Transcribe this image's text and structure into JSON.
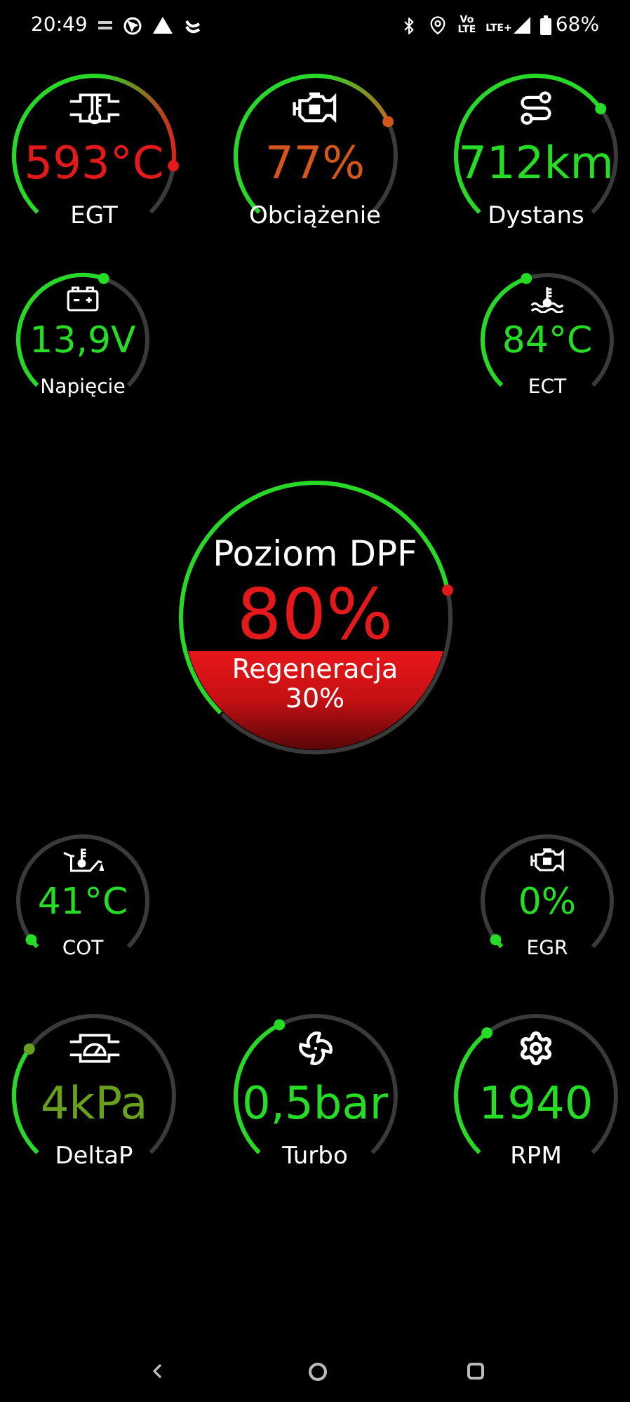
{
  "status_bar": {
    "time": "20:49",
    "volte_top": "Vo",
    "volte_bottom": "LTE",
    "network": "LTE+",
    "battery": "68%"
  },
  "top_row": [
    {
      "value": "593°C",
      "label": "EGT",
      "color": "#e3191b"
    },
    {
      "value": "77%",
      "label": "Obciążenie",
      "color": "#d4561c"
    },
    {
      "value": "712km",
      "label": "Dystans",
      "color": "#25dd25"
    }
  ],
  "middle_row": [
    {
      "value": "13,9V",
      "label": "Napięcie",
      "color": "#25dd25"
    },
    {
      "value": "84°C",
      "label": "ECT",
      "color": "#25dd25"
    }
  ],
  "dpf": {
    "title": "Poziom DPF",
    "value": "80%",
    "color": "#e3191b",
    "regeneration_label": "Regeneracja",
    "regeneration_value": "30%"
  },
  "lower_row": [
    {
      "value": "41°C",
      "label": "COT",
      "color": "#25dd25"
    },
    {
      "value": "0%",
      "label": "EGR",
      "color": "#25dd25"
    }
  ],
  "bottom_row": [
    {
      "value": "4kPa",
      "label": "DeltaP",
      "color": "#6a9e1e"
    },
    {
      "value": "0,5bar",
      "label": "Turbo",
      "color": "#25dd25"
    },
    {
      "value": "1940",
      "label": "RPM",
      "color": "#25dd25"
    }
  ]
}
